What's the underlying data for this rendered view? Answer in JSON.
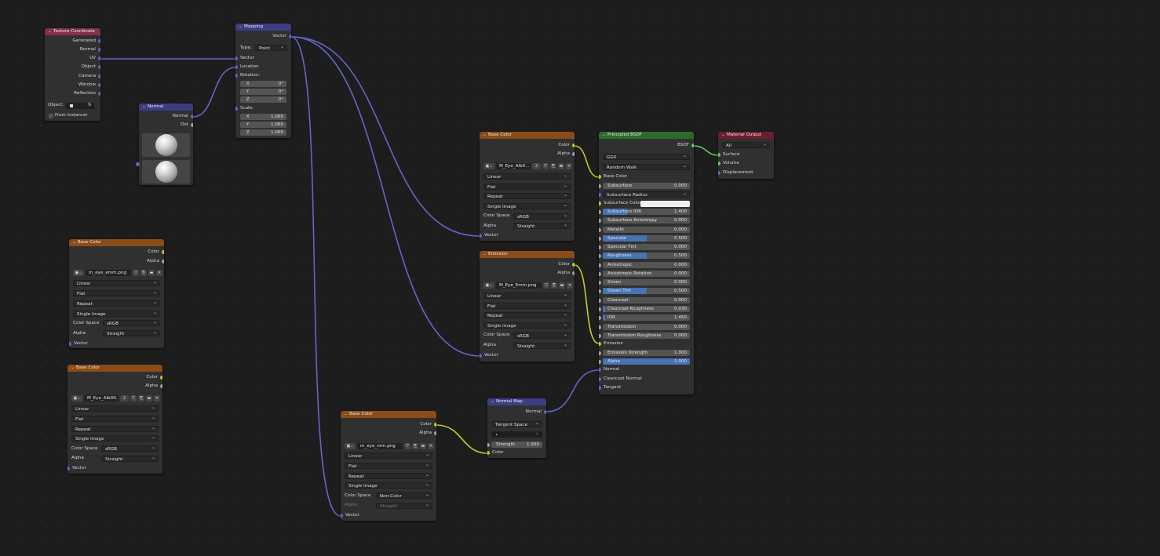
{
  "colors": {
    "background": "#1d1d1d",
    "node_body": "#303030",
    "header_texture": "#83314a",
    "header_vector": "#3c3c83",
    "header_image": "#8a4c18",
    "header_shader": "#2c6b2c",
    "header_output": "#6e1d30",
    "socket_vector": "#6363c7",
    "socket_color": "#c7c729",
    "socket_float": "#a1a1a1",
    "socket_shader": "#63c763",
    "slider_fill": "#4772b3"
  },
  "texture_coordinate": {
    "title": "Texture Coordinate",
    "outputs": [
      "Generated",
      "Normal",
      "UV",
      "Object",
      "Camera",
      "Window",
      "Reflection"
    ],
    "object_label": "Object:",
    "from_instancer": "From Instancer"
  },
  "normal": {
    "title": "Normal",
    "outputs": [
      "Normal",
      "Dot"
    ]
  },
  "mapping": {
    "title": "Mapping",
    "output": "Vector",
    "type_label": "Type:",
    "type_value": "Point",
    "vector": "Vector",
    "location": "Location",
    "rotation_label": "Rotation:",
    "rotation": [
      {
        "axis": "X",
        "value": "0°"
      },
      {
        "axis": "Y",
        "value": "0°"
      },
      {
        "axis": "Z",
        "value": "0°"
      }
    ],
    "scale_label": "Scale:",
    "scale": [
      {
        "axis": "X",
        "value": "1.000"
      },
      {
        "axis": "Y",
        "value": "1.000"
      },
      {
        "axis": "Z",
        "value": "1.000"
      }
    ]
  },
  "common": {
    "color": "Color",
    "alpha": "Alpha",
    "vector": "Vector",
    "linear": "Linear",
    "flat": "Flat",
    "repeat": "Repeat",
    "single_image": "Single Image",
    "color_space": "Color Space",
    "srgb": "sRGB",
    "straight": "Straight",
    "non_color": "Non-Color",
    "users_2": "2"
  },
  "image_nodes": {
    "left1": {
      "title": "Base Color",
      "image": "m_eye_emm.png"
    },
    "left2": {
      "title": "Base Color",
      "image": "M_Eye_Alb00..."
    },
    "mid_base": {
      "title": "Base Color",
      "image": "M_Eye_Alb0..."
    },
    "mid_emission": {
      "title": "Emission",
      "image": "M_Eye_Emm.png"
    },
    "bottom_normal": {
      "title": "Base Color",
      "image": "m_eye_nrm.png"
    }
  },
  "normal_map": {
    "title": "Normal Map",
    "output": "Normal",
    "space": "Tangent Space",
    "uv": "•",
    "strength_label": "Strength",
    "strength_value": "1.000",
    "color": "Color"
  },
  "principled": {
    "title": "Principled BSDF",
    "output": "BSDF",
    "distribution": "GGX",
    "subsurface_method": "Random Walk",
    "base_color": "Base Color",
    "subsurface_radius": "Subsurface Radius",
    "subsurface_color": "Subsurface Color",
    "sliders": [
      {
        "label": "Subsurface",
        "value": "0.000",
        "fill": 0
      },
      {
        "label": "Subsurface IOR",
        "value": "1.400",
        "fill": 0.28
      },
      {
        "label": "Subsurface Anisotropy",
        "value": "0.000",
        "fill": 0
      },
      {
        "label": "Metallic",
        "value": "0.000",
        "fill": 0
      },
      {
        "label": "Specular",
        "value": "0.500",
        "fill": 0.5
      },
      {
        "label": "Specular Tint",
        "value": "0.000",
        "fill": 0
      },
      {
        "label": "Roughness",
        "value": "0.500",
        "fill": 0.5
      },
      {
        "label": "Anisotropic",
        "value": "0.000",
        "fill": 0
      },
      {
        "label": "Anisotropic Rotation",
        "value": "0.000",
        "fill": 0
      },
      {
        "label": "Sheen",
        "value": "0.000",
        "fill": 0
      },
      {
        "label": "Sheen Tint",
        "value": "0.500",
        "fill": 0.5
      },
      {
        "label": "Clearcoat",
        "value": "0.000",
        "fill": 0
      },
      {
        "label": "Clearcoat Roughness",
        "value": "0.030",
        "fill": 0.03
      },
      {
        "label": "IOR",
        "value": "1.450",
        "fill": 0.03
      },
      {
        "label": "Transmission",
        "value": "0.000",
        "fill": 0
      },
      {
        "label": "Transmission Roughness",
        "value": "0.000",
        "fill": 0
      }
    ],
    "emission": "Emission",
    "emission_strength": {
      "label": "Emission Strength",
      "value": "1.000",
      "fill": 0
    },
    "alpha": {
      "label": "Alpha",
      "value": "1.000",
      "fill": 1
    },
    "normal": "Normal",
    "clearcoat_normal": "Clearcoat Normal",
    "tangent": "Tangent"
  },
  "material_output": {
    "title": "Material Output",
    "target": "All",
    "inputs": [
      "Surface",
      "Volume",
      "Displacement"
    ]
  }
}
